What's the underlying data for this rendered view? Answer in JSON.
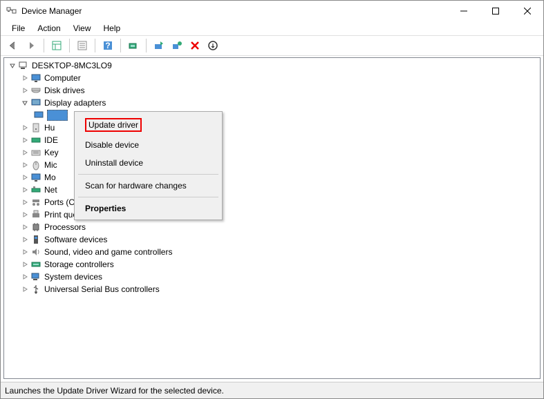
{
  "window": {
    "title": "Device Manager"
  },
  "menu": {
    "file": "File",
    "action": "Action",
    "view": "View",
    "help": "Help"
  },
  "tree": {
    "root": "DESKTOP-8MC3LO9",
    "items": {
      "computer": "Computer",
      "disk": "Disk drives",
      "display": "Display adapters",
      "hid": "Hu",
      "ide": "IDE",
      "keyboard": "Key",
      "mice": "Mic",
      "monitor": "Mo",
      "network": "Net",
      "ports": "Ports (COM & LPT)",
      "print": "Print queues",
      "processors": "Processors",
      "software": "Software devices",
      "sound": "Sound, video and game controllers",
      "storage": "Storage controllers",
      "system": "System devices",
      "usb": "Universal Serial Bus controllers"
    }
  },
  "context_menu": {
    "update": "Update driver",
    "disable": "Disable device",
    "uninstall": "Uninstall device",
    "scan": "Scan for hardware changes",
    "properties": "Properties"
  },
  "status": "Launches the Update Driver Wizard for the selected device."
}
